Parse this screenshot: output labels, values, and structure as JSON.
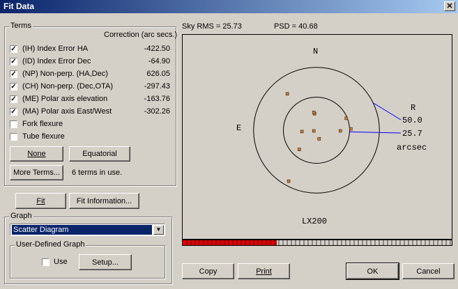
{
  "window": {
    "title": "Fit Data",
    "close_glyph": "✕"
  },
  "terms": {
    "group_label": "Terms",
    "correction_header": "Correction (arc secs.)",
    "items": [
      {
        "label": "(IH) Index Error HA",
        "value": "-422.50",
        "checked": true
      },
      {
        "label": "(ID) Index Error Dec",
        "value": "-64.90",
        "checked": true
      },
      {
        "label": "(NP) Non-perp. (HA,Dec)",
        "value": "626.05",
        "checked": true
      },
      {
        "label": "(CH) Non-perp. (Dec,OTA)",
        "value": "-297.43",
        "checked": true
      },
      {
        "label": "(ME) Polar axis elevation",
        "value": "-163.76",
        "checked": true
      },
      {
        "label": "(MA) Polar axis East/West",
        "value": "-302.26",
        "checked": true
      },
      {
        "label": "Fork flexure",
        "value": "",
        "checked": false
      },
      {
        "label": "Tube flexure",
        "value": "",
        "checked": false
      }
    ],
    "none_button": "None",
    "equatorial_button": "Equatorial",
    "more_terms_button": "More Terms...",
    "terms_in_use": "6 terms in use."
  },
  "fit_button": "Fit",
  "fit_info_button": "Fit Information...",
  "graph": {
    "group_label": "Graph",
    "selected": "Scatter Diagram",
    "user_group_label": "User-Defined Graph",
    "use_label": "Use",
    "use_checked": false,
    "setup_button": "Setup..."
  },
  "stats": {
    "sky_rms": "Sky RMS = 25.73",
    "psd": "PSD = 40.68"
  },
  "plot": {
    "north": "N",
    "east": "E",
    "radius_header": "R",
    "outer_label": "50.0",
    "inner_label": "25.7",
    "unit_label": "arcsec",
    "mount_label": "LX200",
    "points": [
      {
        "x": -44,
        "y": 55
      },
      {
        "x": -3,
        "y": 25
      },
      {
        "x": -4,
        "y": 27
      },
      {
        "x": 45,
        "y": 18
      },
      {
        "x": 52,
        "y": 2
      },
      {
        "x": 36,
        "y": -1
      },
      {
        "x": -4,
        "y": -1
      },
      {
        "x": -22,
        "y": -2
      },
      {
        "x": 4,
        "y": -13
      },
      {
        "x": -26,
        "y": -29
      },
      {
        "x": -42,
        "y": -77
      }
    ],
    "outer_radius_data": 95,
    "inner_radius_data": 50
  },
  "progress": {
    "filled_fraction": 0.35,
    "fill_color": "#e00000"
  },
  "buttons": {
    "copy": "Copy",
    "print": "Print",
    "ok": "OK",
    "cancel": "Cancel"
  }
}
